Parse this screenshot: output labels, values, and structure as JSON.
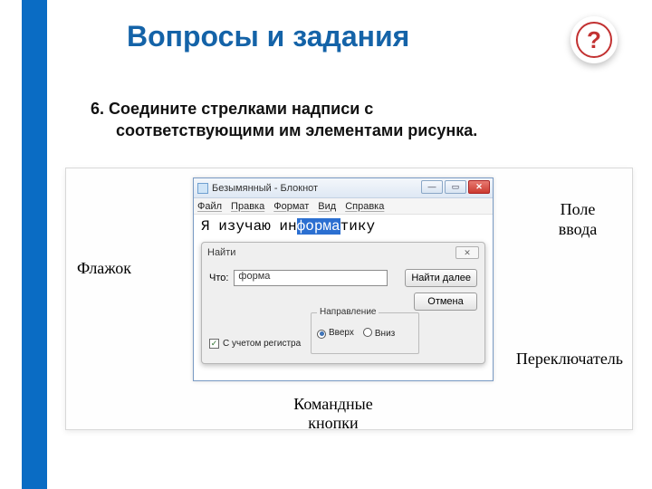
{
  "title": "Вопросы и задания",
  "badge": "?",
  "task": {
    "num": "6.",
    "text1": "Соедините стрелками надписи с",
    "text2": "соответствующими им элементами рисунка."
  },
  "labels": {
    "flag": "Флажок",
    "input_l1": "Поле",
    "input_l2": "ввода",
    "switch": "Переключатель",
    "cmd_l1": "Командные",
    "cmd_l2": "кнопки"
  },
  "win": {
    "title": "Безымянный - Блокнот",
    "menu": [
      "Файл",
      "Правка",
      "Формат",
      "Вид",
      "Справка"
    ],
    "text_pre": "Я изучаю ин",
    "text_sel": "форма",
    "text_post": "тику",
    "ctrl_min": "—",
    "ctrl_max": "▭",
    "ctrl_close": "✕"
  },
  "dlg": {
    "title": "Найти",
    "close": "✕",
    "what": "Что:",
    "value": "форма",
    "find_next": "Найти далее",
    "cancel": "Отмена",
    "group": "Направление",
    "up": "Вверх",
    "down": "Вниз",
    "case": "С учетом регистра"
  }
}
